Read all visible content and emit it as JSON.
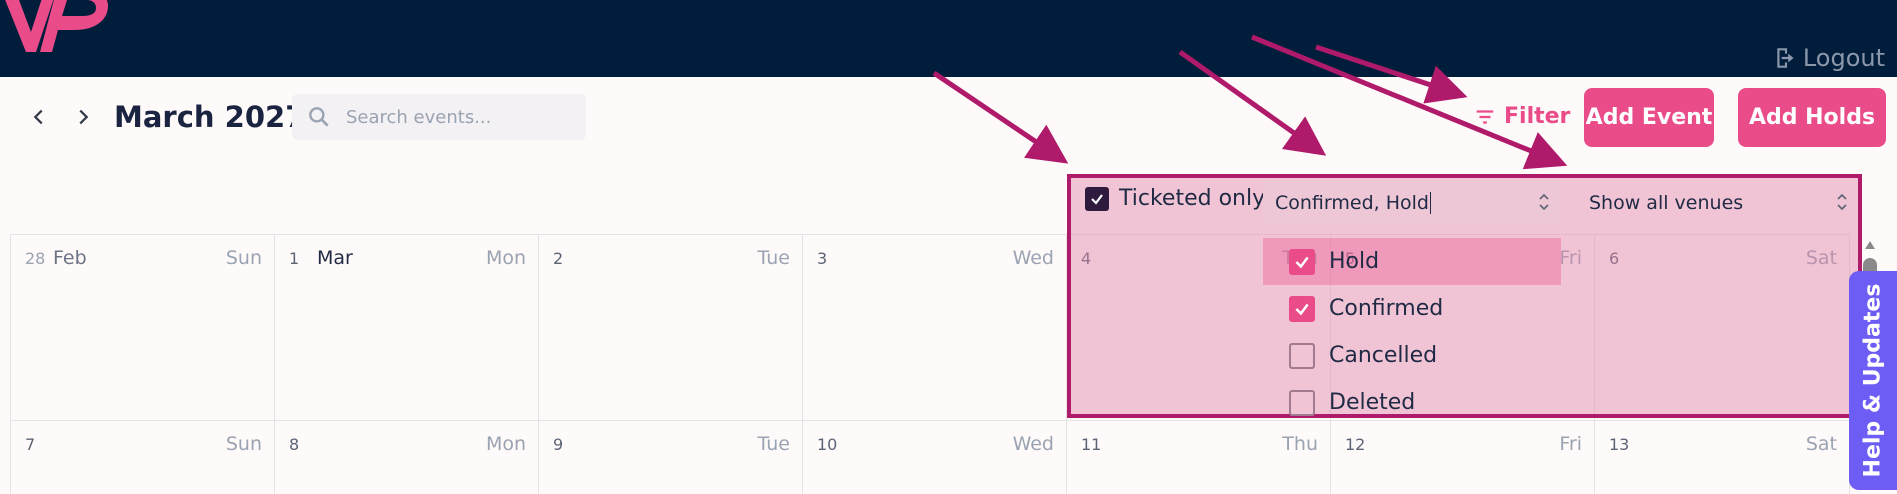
{
  "header": {
    "logout_label": "Logout",
    "colors": {
      "bg": "#001d3b",
      "logo": "#ea4c89"
    }
  },
  "toolbar": {
    "month_title": "March 2027",
    "search_placeholder": "Search events...",
    "filter_label": "Filter",
    "add_event_label": "Add Event",
    "add_holds_label": "Add Holds"
  },
  "filters": {
    "ticketed_label": "Ticketed only",
    "ticketed_checked": true,
    "status_value": "Confirmed, Hold",
    "venue_value": "Show all venues",
    "status_options": [
      {
        "label": "Hold",
        "checked": true,
        "active": true
      },
      {
        "label": "Confirmed",
        "checked": true,
        "active": false
      },
      {
        "label": "Cancelled",
        "checked": false,
        "active": false
      },
      {
        "label": "Deleted",
        "checked": false,
        "active": false
      }
    ]
  },
  "calendar": {
    "week1": [
      {
        "num": "28",
        "month": "Feb",
        "dow": "Sun"
      },
      {
        "num": "1",
        "month": "Mar",
        "dow": "Mon"
      },
      {
        "num": "2",
        "dow": "Tue"
      },
      {
        "num": "3",
        "dow": "Wed"
      },
      {
        "num": "4",
        "dow": "Thu"
      },
      {
        "num": "5",
        "dow": "Fri"
      },
      {
        "num": "6",
        "dow": "Sat"
      }
    ],
    "week2": [
      {
        "num": "7",
        "dow": "Sun"
      },
      {
        "num": "8",
        "dow": "Mon"
      },
      {
        "num": "9",
        "dow": "Tue"
      },
      {
        "num": "10",
        "dow": "Wed"
      },
      {
        "num": "11",
        "dow": "Thu"
      },
      {
        "num": "12",
        "dow": "Fri"
      },
      {
        "num": "13",
        "dow": "Sat"
      }
    ]
  },
  "help_tab_label": "Help & Updates",
  "colors": {
    "accent": "#ea4c89",
    "annotation": "#b01a6b",
    "help_tab": "#6d5df5"
  }
}
